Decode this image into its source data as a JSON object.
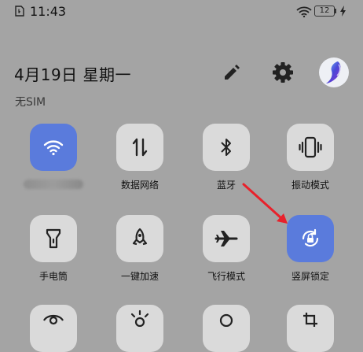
{
  "status_bar": {
    "time": "11:43",
    "battery_level": "12"
  },
  "header": {
    "date_text": "4月19日 星期一",
    "sim_status": "无SIM"
  },
  "tiles": [
    {
      "id": "wifi",
      "label": "",
      "icon": "wifi-icon",
      "active": true
    },
    {
      "id": "data",
      "label": "数据网络",
      "icon": "data-network-icon",
      "active": false
    },
    {
      "id": "bluetooth",
      "label": "蓝牙",
      "icon": "bluetooth-icon",
      "active": false
    },
    {
      "id": "vibrate",
      "label": "振动模式",
      "icon": "vibrate-icon",
      "active": false
    },
    {
      "id": "flashlight",
      "label": "手电筒",
      "icon": "flashlight-icon",
      "active": false
    },
    {
      "id": "boost",
      "label": "一键加速",
      "icon": "rocket-icon",
      "active": false
    },
    {
      "id": "airplane",
      "label": "飞行模式",
      "icon": "airplane-icon",
      "active": false
    },
    {
      "id": "rotation_lock",
      "label": "竖屏锁定",
      "icon": "rotation-lock-icon",
      "active": true
    }
  ],
  "colors": {
    "background": "#a4a4a4",
    "tile_inactive": "#dadada",
    "tile_active": "#5a7bdc",
    "annotation_arrow": "#e8212b"
  }
}
